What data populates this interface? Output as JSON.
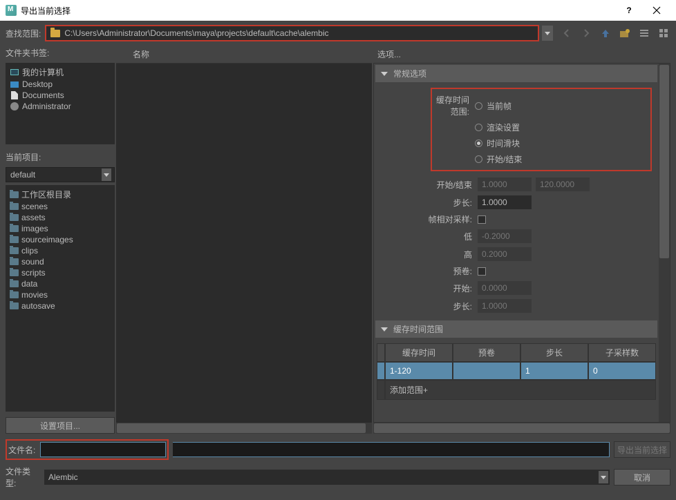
{
  "window": {
    "title": "导出当前选择"
  },
  "pathbar": {
    "label": "查找范围:",
    "path": "C:\\Users\\Administrator\\Documents\\maya\\projects\\default\\cache\\alembic"
  },
  "bookmarks": {
    "label": "文件夹书签:",
    "items": [
      {
        "icon": "monitor",
        "label": "我的计算机"
      },
      {
        "icon": "desktop",
        "label": "Desktop"
      },
      {
        "icon": "document",
        "label": "Documents"
      },
      {
        "icon": "user",
        "label": "Administrator"
      }
    ]
  },
  "currentProject": {
    "label": "当前项目:",
    "value": "default",
    "items": [
      {
        "label": "工作区根目录"
      },
      {
        "label": "scenes"
      },
      {
        "label": "assets"
      },
      {
        "label": "images"
      },
      {
        "label": "sourceimages"
      },
      {
        "label": "clips"
      },
      {
        "label": "sound"
      },
      {
        "label": "scripts"
      },
      {
        "label": "data"
      },
      {
        "label": "movies"
      },
      {
        "label": "autosave"
      }
    ],
    "setButton": "设置项目..."
  },
  "fileList": {
    "header": "名称"
  },
  "options": {
    "header": "选项...",
    "generalSection": "常规选项",
    "cacheTimeRange": {
      "label": "缓存时间范围:",
      "opts": [
        "当前帧",
        "渲染设置",
        "时间滑块",
        "开始/结束"
      ],
      "selected": 2
    },
    "startEnd": {
      "label": "开始/结束",
      "start": "1.0000",
      "end": "120.0000"
    },
    "step": {
      "label": "步长:",
      "value": "1.0000"
    },
    "frameRelative": {
      "label": "帧相对采样:"
    },
    "low": {
      "label": "低",
      "value": "-0.2000"
    },
    "high": {
      "label": "高",
      "value": "0.2000"
    },
    "preroll": {
      "label": "预卷:"
    },
    "prerollStart": {
      "label": "开始:",
      "value": "0.0000"
    },
    "prerollStep": {
      "label": "步长:",
      "value": "1.0000"
    },
    "cacheRangeSection": "缓存时间范围",
    "table": {
      "headers": [
        "缓存时间",
        "预卷",
        "步长",
        "子采样数"
      ],
      "row": [
        "1-120",
        "",
        "1",
        "0"
      ],
      "addRow": "添加范围+"
    }
  },
  "bottom": {
    "filenameLabel": "文件名:",
    "filetypeLabel": "文件类型:",
    "filetypeValue": "Alembic",
    "exportBtn": "导出当前选择",
    "cancelBtn": "取消"
  }
}
